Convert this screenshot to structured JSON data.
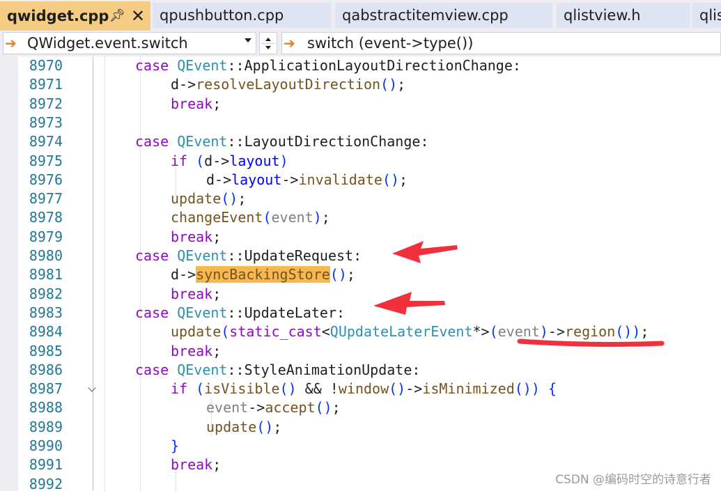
{
  "tabs": [
    {
      "label": "qwidget.cpp",
      "active": true
    },
    {
      "label": "qpushbutton.cpp",
      "active": false
    },
    {
      "label": "qabstractitemview.cpp",
      "active": false
    },
    {
      "label": "qlistview.h",
      "active": false
    },
    {
      "label": "qlis",
      "active": false
    }
  ],
  "nav": {
    "scope": "QWidget.event.switch",
    "member": "switch (event->type())"
  },
  "editor": {
    "lines": [
      {
        "number": "8970",
        "indent": 2,
        "tokens": [
          {
            "t": "case ",
            "c": "kw"
          },
          {
            "t": "QEvent",
            "c": "ty"
          },
          {
            "t": "::",
            "c": ""
          },
          {
            "t": "ApplicationLayoutDirectionChange",
            "c": ""
          },
          {
            "t": ":",
            "c": ""
          }
        ]
      },
      {
        "number": "8971",
        "indent": 3,
        "tokens": [
          {
            "t": "d",
            "c": ""
          },
          {
            "t": "->",
            "c": ""
          },
          {
            "t": "resolveLayoutDirection",
            "c": "fn"
          },
          {
            "t": "()",
            "c": "br"
          },
          {
            "t": ";",
            "c": ""
          }
        ]
      },
      {
        "number": "8972",
        "indent": 3,
        "tokens": [
          {
            "t": "break",
            "c": "kw"
          },
          {
            "t": ";",
            "c": ""
          }
        ]
      },
      {
        "number": "8973",
        "indent": 0,
        "tokens": []
      },
      {
        "number": "8974",
        "indent": 2,
        "tokens": [
          {
            "t": "case ",
            "c": "kw"
          },
          {
            "t": "QEvent",
            "c": "ty"
          },
          {
            "t": "::",
            "c": ""
          },
          {
            "t": "LayoutDirectionChange",
            "c": ""
          },
          {
            "t": ":",
            "c": ""
          }
        ]
      },
      {
        "number": "8975",
        "indent": 3,
        "tokens": [
          {
            "t": "if ",
            "c": "kw"
          },
          {
            "t": "(",
            "c": "br"
          },
          {
            "t": "d",
            "c": ""
          },
          {
            "t": "->",
            "c": ""
          },
          {
            "t": "layout",
            "c": "mem"
          },
          {
            "t": ")",
            "c": "br"
          }
        ]
      },
      {
        "number": "8976",
        "indent": 4,
        "tokens": [
          {
            "t": "d",
            "c": ""
          },
          {
            "t": "->",
            "c": ""
          },
          {
            "t": "layout",
            "c": "mem"
          },
          {
            "t": "->",
            "c": ""
          },
          {
            "t": "invalidate",
            "c": "fn"
          },
          {
            "t": "()",
            "c": "br"
          },
          {
            "t": ";",
            "c": ""
          }
        ]
      },
      {
        "number": "8977",
        "indent": 3,
        "tokens": [
          {
            "t": "update",
            "c": "fn"
          },
          {
            "t": "()",
            "c": "br"
          },
          {
            "t": ";",
            "c": ""
          }
        ]
      },
      {
        "number": "8978",
        "indent": 3,
        "tokens": [
          {
            "t": "changeEvent",
            "c": "fn"
          },
          {
            "t": "(",
            "c": "br"
          },
          {
            "t": "event",
            "c": "par"
          },
          {
            "t": ")",
            "c": "br"
          },
          {
            "t": ";",
            "c": ""
          }
        ]
      },
      {
        "number": "8979",
        "indent": 3,
        "tokens": [
          {
            "t": "break",
            "c": "kw"
          },
          {
            "t": ";",
            "c": ""
          }
        ]
      },
      {
        "number": "8980",
        "indent": 2,
        "tokens": [
          {
            "t": "case ",
            "c": "kw"
          },
          {
            "t": "QEvent",
            "c": "ty"
          },
          {
            "t": "::",
            "c": ""
          },
          {
            "t": "UpdateRequest",
            "c": ""
          },
          {
            "t": ":",
            "c": ""
          }
        ]
      },
      {
        "number": "8981",
        "indent": 3,
        "tokens": [
          {
            "t": "d",
            "c": ""
          },
          {
            "t": "->",
            "c": ""
          },
          {
            "t": "syncBackingStore",
            "c": "fn hl"
          },
          {
            "t": "()",
            "c": "br"
          },
          {
            "t": ";",
            "c": ""
          }
        ]
      },
      {
        "number": "8982",
        "indent": 3,
        "tokens": [
          {
            "t": "break",
            "c": "kw"
          },
          {
            "t": ";",
            "c": ""
          }
        ]
      },
      {
        "number": "8983",
        "indent": 2,
        "tokens": [
          {
            "t": "case ",
            "c": "kw"
          },
          {
            "t": "QEvent",
            "c": "ty"
          },
          {
            "t": "::",
            "c": ""
          },
          {
            "t": "UpdateLater",
            "c": ""
          },
          {
            "t": ":",
            "c": ""
          }
        ]
      },
      {
        "number": "8984",
        "indent": 3,
        "tokens": [
          {
            "t": "update",
            "c": "fn"
          },
          {
            "t": "(",
            "c": "br"
          },
          {
            "t": "static_cast",
            "c": "kw"
          },
          {
            "t": "<",
            "c": ""
          },
          {
            "t": "QUpdateLaterEvent",
            "c": "ty"
          },
          {
            "t": "*>",
            "c": ""
          },
          {
            "t": "(",
            "c": "br"
          },
          {
            "t": "event",
            "c": "par"
          },
          {
            "t": ")",
            "c": "br"
          },
          {
            "t": "->",
            "c": ""
          },
          {
            "t": "region",
            "c": "fn"
          },
          {
            "t": "())",
            "c": "br"
          },
          {
            "t": ";",
            "c": ""
          }
        ]
      },
      {
        "number": "8985",
        "indent": 3,
        "tokens": [
          {
            "t": "break",
            "c": "kw"
          },
          {
            "t": ";",
            "c": ""
          }
        ]
      },
      {
        "number": "8986",
        "indent": 2,
        "tokens": [
          {
            "t": "case ",
            "c": "kw"
          },
          {
            "t": "QEvent",
            "c": "ty"
          },
          {
            "t": "::",
            "c": ""
          },
          {
            "t": "StyleAnimationUpdate",
            "c": ""
          },
          {
            "t": ":",
            "c": ""
          }
        ]
      },
      {
        "number": "8987",
        "indent": 3,
        "fold": true,
        "tokens": [
          {
            "t": "if ",
            "c": "kw"
          },
          {
            "t": "(",
            "c": "br"
          },
          {
            "t": "isVisible",
            "c": "fn"
          },
          {
            "t": "()",
            "c": "br"
          },
          {
            "t": " && !",
            "c": ""
          },
          {
            "t": "window",
            "c": "fn"
          },
          {
            "t": "()",
            "c": "br"
          },
          {
            "t": "->",
            "c": ""
          },
          {
            "t": "isMinimized",
            "c": "fn"
          },
          {
            "t": "())",
            "c": "br"
          },
          {
            "t": " {",
            "c": "br"
          }
        ]
      },
      {
        "number": "8988",
        "indent": 4,
        "tokens": [
          {
            "t": "event",
            "c": "par"
          },
          {
            "t": "->",
            "c": ""
          },
          {
            "t": "accept",
            "c": "fn"
          },
          {
            "t": "()",
            "c": "br"
          },
          {
            "t": ";",
            "c": ""
          }
        ]
      },
      {
        "number": "8989",
        "indent": 4,
        "tokens": [
          {
            "t": "update",
            "c": "fn"
          },
          {
            "t": "()",
            "c": "br"
          },
          {
            "t": ";",
            "c": ""
          }
        ]
      },
      {
        "number": "8990",
        "indent": 3,
        "tokens": [
          {
            "t": "}",
            "c": "br"
          }
        ]
      },
      {
        "number": "8991",
        "indent": 3,
        "tokens": [
          {
            "t": "break",
            "c": "kw"
          },
          {
            "t": ";",
            "c": ""
          }
        ]
      },
      {
        "number": "8992",
        "indent": 0,
        "tokens": []
      }
    ]
  },
  "watermark": "CSDN @编码时空的诗意行者",
  "colors": {
    "annotation": "#f0303a",
    "active_tab": "#f5cc84",
    "highlight": "#f7b850"
  }
}
